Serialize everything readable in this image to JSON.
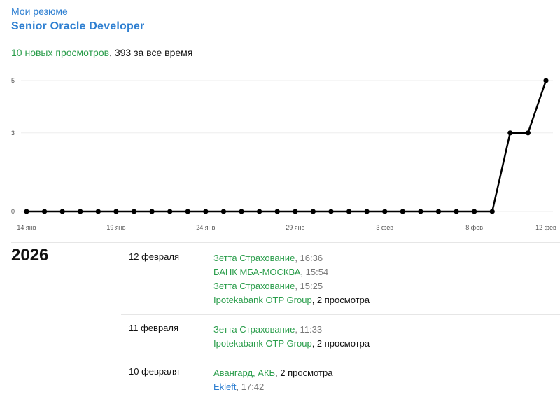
{
  "header": {
    "breadcrumb": "Мои резюме",
    "title": "Senior Oracle Developer",
    "new_views": "10 новых просмотров",
    "separator": ", ",
    "total_views": "393 за все время"
  },
  "chart_data": {
    "type": "line",
    "x": [
      "14 янв",
      "15 янв",
      "16 янв",
      "17 янв",
      "18 янв",
      "19 янв",
      "20 янв",
      "21 янв",
      "22 янв",
      "23 янв",
      "24 янв",
      "25 янв",
      "26 янв",
      "27 янв",
      "28 янв",
      "29 янв",
      "30 янв",
      "31 янв",
      "1 фев",
      "2 фев",
      "3 фев",
      "4 фев",
      "5 фев",
      "6 фев",
      "7 фев",
      "8 фев",
      "9 фев",
      "10 фев",
      "11 фев",
      "12 фев"
    ],
    "values": [
      0,
      0,
      0,
      0,
      0,
      0,
      0,
      0,
      0,
      0,
      0,
      0,
      0,
      0,
      0,
      0,
      0,
      0,
      0,
      0,
      0,
      0,
      0,
      0,
      0,
      0,
      0,
      3,
      3,
      5
    ],
    "xtick_labels": [
      "14 янв",
      "19 янв",
      "24 янв",
      "29 янв",
      "3 фев",
      "8 фев",
      "12 фев"
    ],
    "ytick_labels": [
      "0",
      "3",
      "5"
    ],
    "ylim": [
      0,
      5
    ],
    "grid": true,
    "line_color": "#000000"
  },
  "history": {
    "year": "2026",
    "days": [
      {
        "date": "12 февраля",
        "entries": [
          {
            "company": "Зетта Страхование",
            "sep": ", ",
            "detail": "16:36",
            "kind": "time",
            "color": "green"
          },
          {
            "company": "БАНК МБА-МОСКВА",
            "sep": ", ",
            "detail": "15:54",
            "kind": "time",
            "color": "green"
          },
          {
            "company": "Зетта Страхование",
            "sep": ", ",
            "detail": "15:25",
            "kind": "time",
            "color": "green"
          },
          {
            "company": "Ipotekabank OTP Group",
            "sep": ", ",
            "detail": "2 просмотра",
            "kind": "count",
            "color": "green"
          }
        ]
      },
      {
        "date": "11 февраля",
        "entries": [
          {
            "company": "Зетта Страхование",
            "sep": ", ",
            "detail": "11:33",
            "kind": "time",
            "color": "green"
          },
          {
            "company": "Ipotekabank OTP Group",
            "sep": ", ",
            "detail": "2 просмотра",
            "kind": "count",
            "color": "green"
          }
        ]
      },
      {
        "date": "10 февраля",
        "entries": [
          {
            "company": "Авангард, АКБ",
            "sep": ", ",
            "detail": "2 просмотра",
            "kind": "count",
            "color": "green"
          },
          {
            "company": "Ekleft",
            "sep": ", ",
            "detail": "17:42",
            "kind": "time",
            "color": "blue"
          }
        ]
      }
    ]
  }
}
